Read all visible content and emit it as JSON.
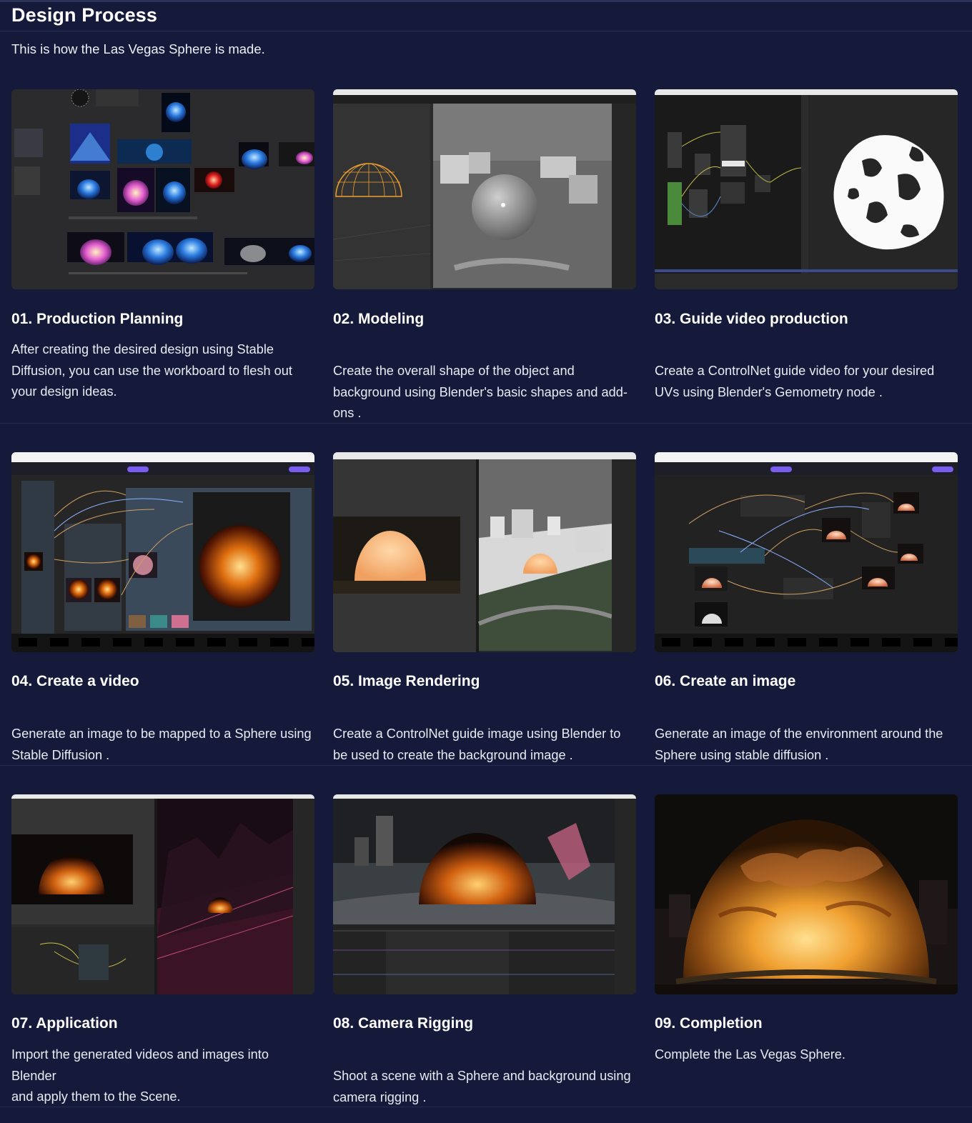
{
  "header": {
    "title": "Design Process",
    "subtitle": "This is how the Las Vegas Sphere is made."
  },
  "steps": [
    {
      "title": "01. Production Planning",
      "desc": "After creating the desired design using Stable Diffusion, you can use the workboard to flesh out your design ideas."
    },
    {
      "title": "02. Modeling",
      "desc": "Create the overall shape of the object and background using Blender's basic shapes and add-ons ."
    },
    {
      "title": "03. Guide video production",
      "desc": "Create a ControlNet guide video for your desired UVs using Blender's Gemometry node ."
    },
    {
      "title": "04. Create a video",
      "desc": "Generate an image to be mapped to a Sphere using Stable Diffusion ."
    },
    {
      "title": "05. Image Rendering",
      "desc": "Create a ControlNet guide image using Blender to be used to create the background image ."
    },
    {
      "title": "06. Create an image",
      "desc": "Generate an image of the environment around the Sphere using stable diffusion ."
    },
    {
      "title": "07. Application",
      "desc_lines": [
        "Import the generated videos and images into Blender",
        "and apply them to the Scene."
      ]
    },
    {
      "title": "08. Camera Rigging",
      "desc": "Shoot a scene with a Sphere and background using camera rigging ."
    },
    {
      "title": "09. Completion",
      "desc": "Complete the Las Vegas Sphere."
    }
  ],
  "thumbnails": [
    {
      "name": "workboard-screenshot"
    },
    {
      "name": "blender-modeling-screenshot"
    },
    {
      "name": "geometry-node-screenshot"
    },
    {
      "name": "comfyui-video-screenshot"
    },
    {
      "name": "blender-render-screenshot"
    },
    {
      "name": "comfyui-image-screenshot"
    },
    {
      "name": "blender-application-screenshot"
    },
    {
      "name": "camera-rigging-screenshot"
    },
    {
      "name": "final-sphere-render"
    }
  ],
  "colors": {
    "background": "#151a3a",
    "text": "#ffffff",
    "muted_text": "#e8eaf4",
    "divider": "#262d52"
  }
}
